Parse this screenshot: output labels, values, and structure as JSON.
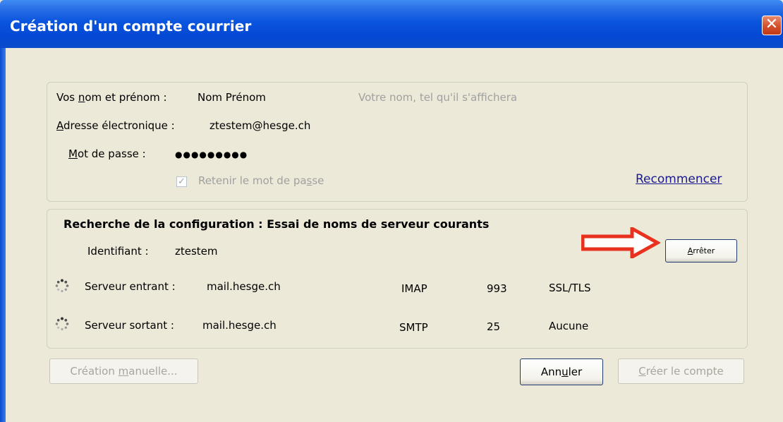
{
  "window": {
    "title": "Création d'un compte courrier",
    "close_label": "✕"
  },
  "account": {
    "name_label_pre": "Vos ",
    "name_label_u": "n",
    "name_label_post": "om et prénom :",
    "name_value": "Nom Prénom",
    "name_hint": "Votre nom, tel qu'il s'affichera",
    "email_label_u": "A",
    "email_label_post": "dresse électronique :",
    "email_value": "ztestem@hesge.ch",
    "password_label_u": "M",
    "password_label_post": "ot de passe :",
    "password_value": "●●●●●●●●●",
    "remember_pre": "Retenir le mot de pa",
    "remember_u": "s",
    "remember_post": "se",
    "remember_checked": "✓",
    "restart_link": "Recommencer"
  },
  "config": {
    "heading": "Recherche de la configuration : Essai de noms de serveur courants",
    "identifier_label": "Identifiant :",
    "identifier_value": "ztestem",
    "stop_button_u": "A",
    "stop_button_post": "rrêter",
    "incoming": {
      "label": "Serveur entrant :",
      "host": "mail.hesge.ch",
      "protocol": "IMAP",
      "port": "993",
      "security": "SSL/TLS"
    },
    "outgoing": {
      "label": "Serveur sortant :",
      "host": "mail.hesge.ch",
      "protocol": "SMTP",
      "port": "25",
      "security": "Aucune"
    }
  },
  "buttons": {
    "manual_pre": "Création ",
    "manual_u": "m",
    "manual_post": "anuelle...",
    "cancel_pre": "Ann",
    "cancel_u": "u",
    "cancel_post": "ler",
    "create_u": "C",
    "create_post": "réer le compte"
  },
  "colors": {
    "titlebar": "#0a55de",
    "dialog_bg": "#ece9d8",
    "arrow": "#e8321e",
    "link": "#1a1a8c"
  },
  "icons": {
    "spinner": "loading-spinner-icon",
    "arrow": "red-arrow-icon",
    "close": "close-icon"
  }
}
